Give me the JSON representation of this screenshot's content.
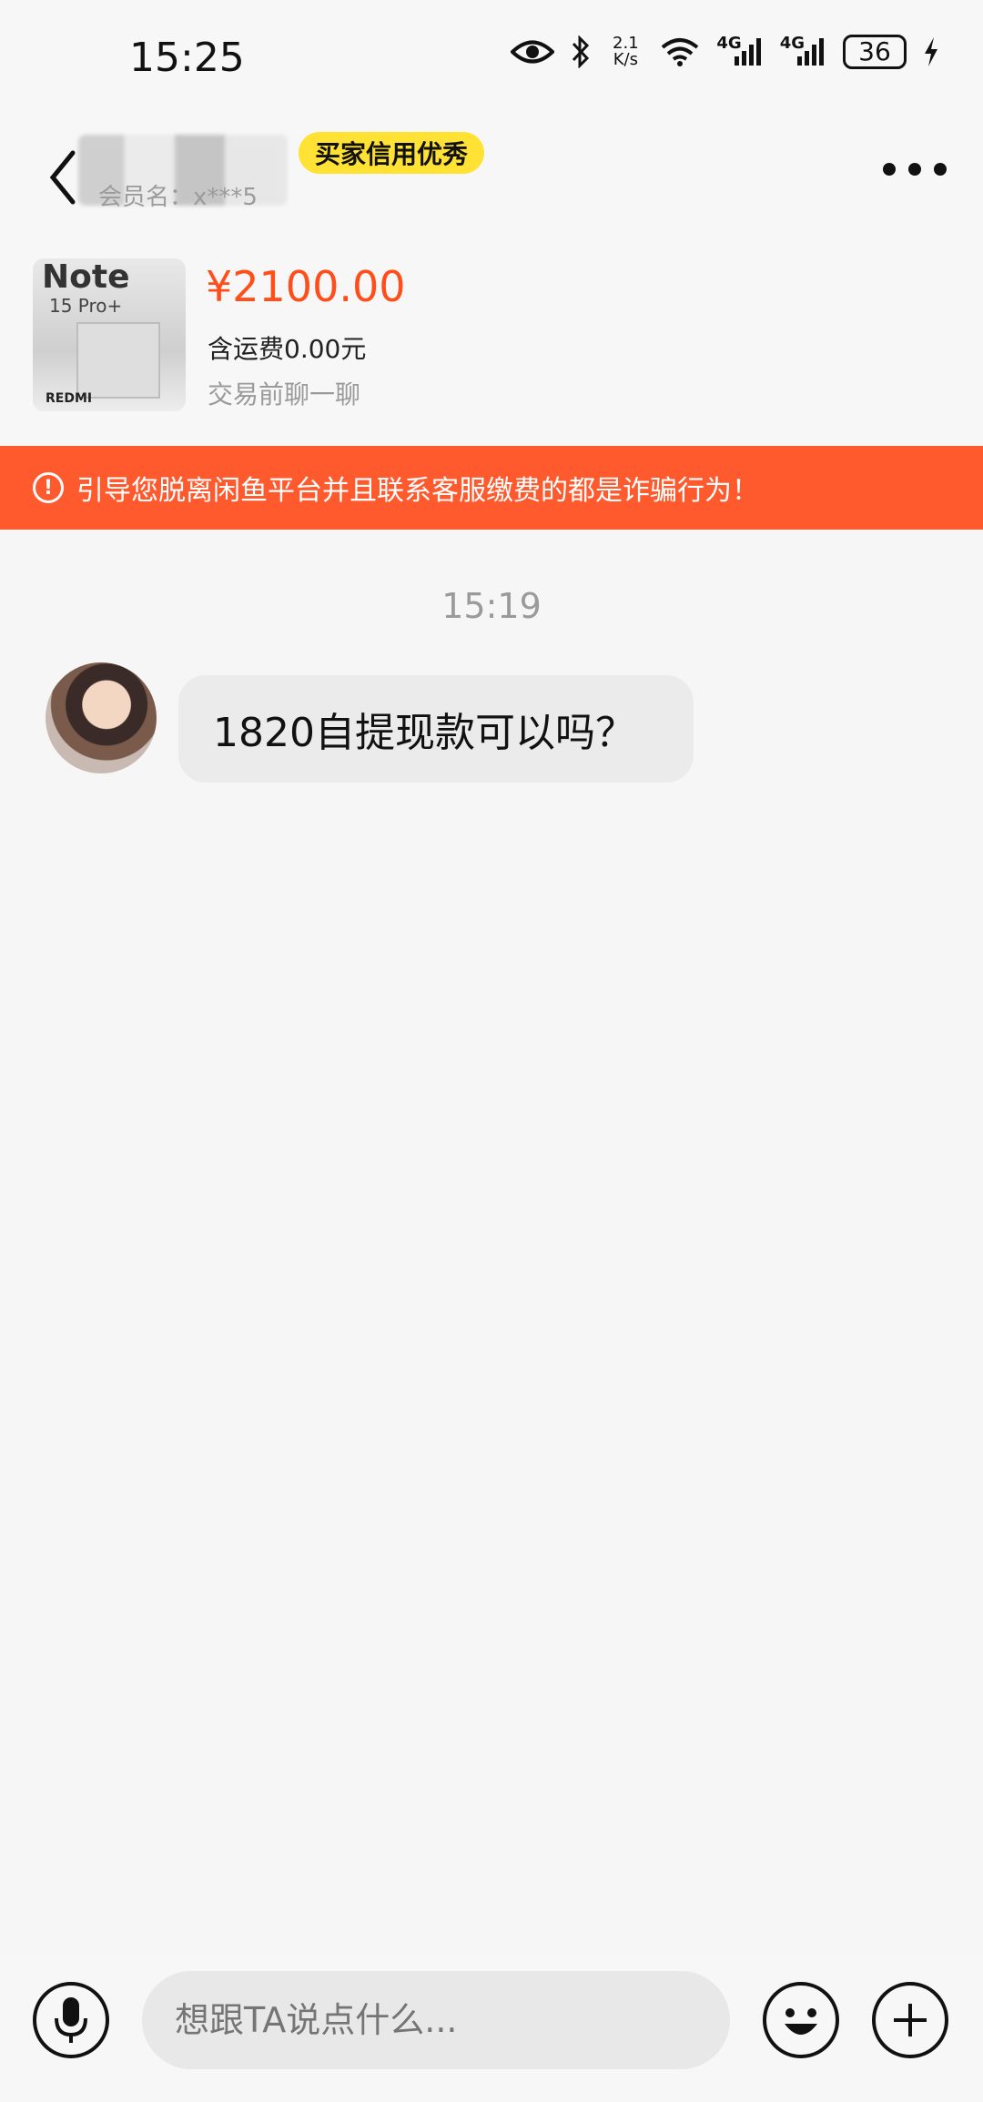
{
  "status_bar": {
    "time": "15:25",
    "network_speed_value": "2.1",
    "network_speed_unit": "K/s",
    "signal_1_label": "4G",
    "signal_2_label": "4G",
    "battery_level": "36",
    "icons": [
      "eye-icon",
      "bluetooth-icon",
      "wifi-icon",
      "signal-icon",
      "signal-icon",
      "battery-icon",
      "charging-icon"
    ]
  },
  "header": {
    "credit_badge": "买家信用优秀",
    "member_name": "会员名：x***5"
  },
  "product": {
    "price": "¥2100.00",
    "shipping": "含运费0.00元",
    "chat_hint": "交易前聊一聊",
    "image_text_1": "Note",
    "image_text_2": "15 Pro+",
    "image_text_3": "REDMI"
  },
  "warning": {
    "text": "引导您脱离闲鱼平台并且联系客服缴费的都是诈骗行为！"
  },
  "chat": {
    "timestamp": "15:19",
    "messages": [
      {
        "text": "1820自提现款可以吗？"
      }
    ]
  },
  "input_bar": {
    "placeholder": "想跟TA说点什么..."
  },
  "colors": {
    "accent": "#ff5a2e",
    "price": "#ff4e1a",
    "badge": "#ffe233"
  }
}
